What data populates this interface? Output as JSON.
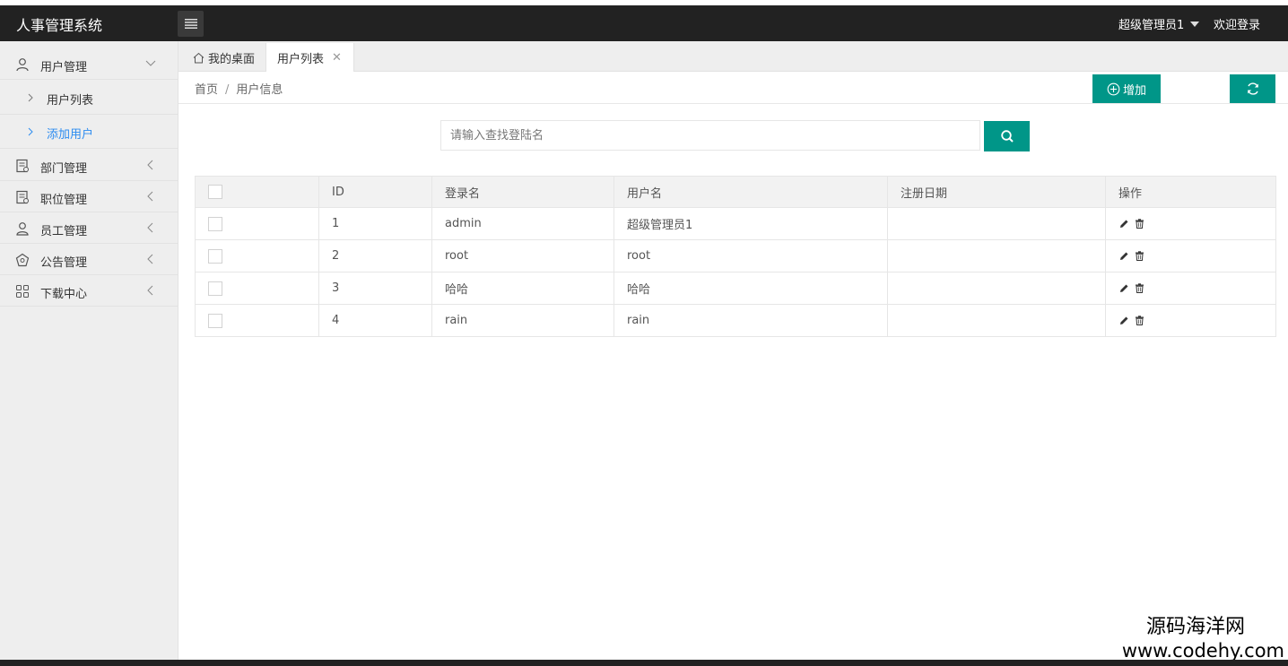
{
  "app": {
    "title": "人事管理系统",
    "user_name": "超级管理员1",
    "logout_label": "欢迎登录"
  },
  "sidebar": {
    "items": [
      {
        "label": "用户管理",
        "icon": "user-icon",
        "expanded": true
      },
      {
        "label": "部门管理",
        "icon": "department-icon",
        "expanded": false
      },
      {
        "label": "职位管理",
        "icon": "position-icon",
        "expanded": false
      },
      {
        "label": "员工管理",
        "icon": "employee-icon",
        "expanded": false
      },
      {
        "label": "公告管理",
        "icon": "notice-icon",
        "expanded": false
      },
      {
        "label": "下载中心",
        "icon": "download-grid-icon",
        "expanded": false
      }
    ],
    "sub_items": [
      {
        "label": "用户列表",
        "active": false
      },
      {
        "label": "添加用户",
        "active": true
      }
    ]
  },
  "tabs": [
    {
      "label": "我的桌面"
    },
    {
      "label": "用户列表"
    }
  ],
  "breadcrumb": {
    "home": "首页",
    "separator": "/",
    "current": "用户信息"
  },
  "toolbar": {
    "add_label": "增加"
  },
  "search": {
    "placeholder": "请输入查找登陆名"
  },
  "table": {
    "headers": [
      "ID",
      "登录名",
      "用户名",
      "注册日期",
      "操作"
    ],
    "rows": [
      {
        "id": "1",
        "login": "admin",
        "username": "超级管理员1",
        "date": ""
      },
      {
        "id": "2",
        "login": "root",
        "username": "root",
        "date": ""
      },
      {
        "id": "3",
        "login": "哈哈",
        "username": "哈哈",
        "date": ""
      },
      {
        "id": "4",
        "login": "rain",
        "username": "rain",
        "date": ""
      }
    ]
  },
  "watermark": {
    "cn": "源码海洋网",
    "url": "www.codehy.com"
  },
  "colors": {
    "header_bg": "#222222",
    "accent": "#009688",
    "active_link": "#2d8cf0",
    "sidebar_bg": "#eeeeee"
  }
}
